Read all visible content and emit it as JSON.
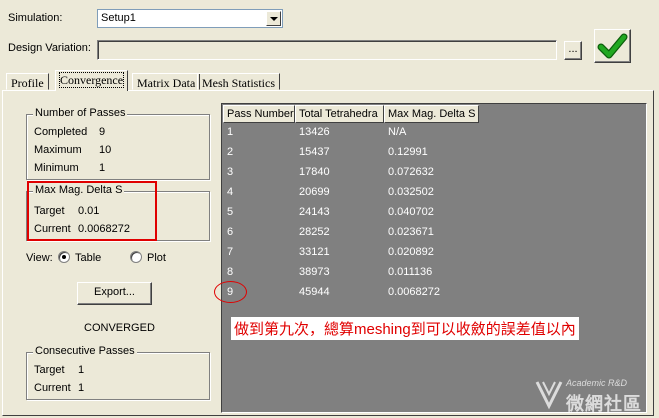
{
  "top": {
    "simulation_label": "Simulation:",
    "simulation_value": "Setup1",
    "design_variation_label": "Design Variation:",
    "design_variation_value": "",
    "browse_label": "...",
    "ok_icon": "green-checkmark-icon"
  },
  "tabs": [
    {
      "label": "Profile"
    },
    {
      "label": "Convergence"
    },
    {
      "label": "Matrix Data"
    },
    {
      "label": "Mesh Statistics"
    }
  ],
  "passes": {
    "title": "Number of Passes",
    "completed_label": "Completed",
    "completed_value": "9",
    "maximum_label": "Maximum",
    "maximum_value": "10",
    "minimum_label": "Minimum",
    "minimum_value": "1"
  },
  "maxmag": {
    "title": "Max Mag. Delta S",
    "target_label": "Target",
    "target_value": "0.01",
    "current_label": "Current",
    "current_value": "0.0068272"
  },
  "view": {
    "label": "View:",
    "table_label": "Table",
    "plot_label": "Plot",
    "selected": "Table"
  },
  "export_label": "Export...",
  "status": "CONVERGED",
  "consecutive": {
    "title": "Consecutive Passes",
    "target_label": "Target",
    "target_value": "1",
    "current_label": "Current",
    "current_value": "1"
  },
  "table": {
    "headers": [
      "Pass Number",
      "Total Tetrahedra",
      "Max Mag. Delta S"
    ],
    "rows": [
      [
        "1",
        "13426",
        "N/A"
      ],
      [
        "2",
        "15437",
        "0.12991"
      ],
      [
        "3",
        "17840",
        "0.072632"
      ],
      [
        "4",
        "20699",
        "0.032502"
      ],
      [
        "5",
        "24143",
        "0.040702"
      ],
      [
        "6",
        "28252",
        "0.023671"
      ],
      [
        "7",
        "33121",
        "0.020892"
      ],
      [
        "8",
        "38973",
        "0.011136"
      ],
      [
        "9",
        "45944",
        "0.0068272"
      ]
    ]
  },
  "annotation": "做到第九次，總算meshing到可以收斂的誤差值以內",
  "watermark": {
    "line1": "Academic R&D",
    "line2": "微網社區"
  },
  "colors": {
    "annotation_red": "#e00000",
    "check_green": "#21a821",
    "table_bg": "#808080"
  }
}
